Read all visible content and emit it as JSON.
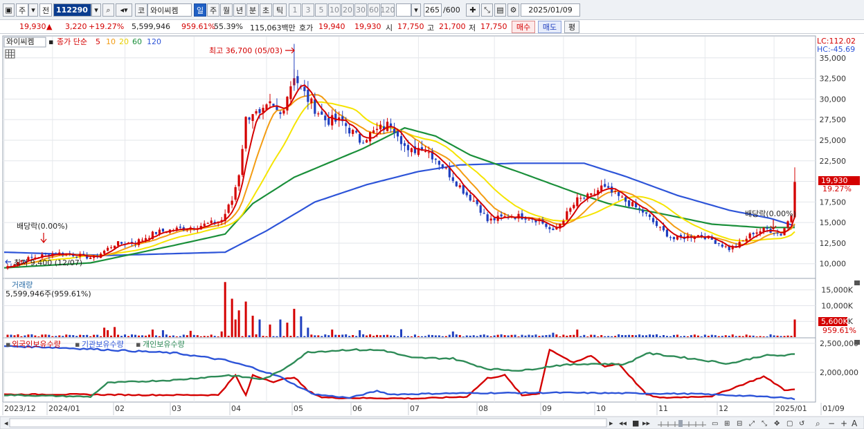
{
  "toolbar": {
    "market": "주",
    "prev_label": "전",
    "code": "112290",
    "kind_label": "코",
    "stock_name": "와이씨켐",
    "periods": [
      "일",
      "주",
      "월",
      "년",
      "분",
      "초",
      "틱"
    ],
    "active_period": "일",
    "intervals": [
      "1",
      "3",
      "5",
      "10",
      "20",
      "30",
      "60",
      "120"
    ],
    "count": "265",
    "count_max": "/600",
    "date": "2025/01/09"
  },
  "quote": {
    "price": "19,930",
    "arrow": "▲",
    "change": "3,220",
    "change_pct": "+19.27%",
    "volume": "5,599,946",
    "volume_pct": "959.61%",
    "turnover": "55.39%",
    "amount": "115,063백만",
    "ask_label": "호가",
    "ask": "19,940",
    "bid": "19,930",
    "open_label": "시",
    "open": "17,750",
    "high_label": "고",
    "high": "21,700",
    "low_label": "저",
    "low": "17,750",
    "buy_label": "매수",
    "sell_label": "매도",
    "eval_label": "평"
  },
  "price_panel": {
    "legend_name": "와이씨켐",
    "legend_ma": "종가 단순",
    "ma_periods": [
      "5",
      "10",
      "20",
      "60",
      "120"
    ],
    "ma_colors": [
      "#d40000",
      "#f39c12",
      "#f5e400",
      "#1a8f3a",
      "#2d54d8"
    ],
    "lc": "LC:112.02",
    "hc": "HC:-45.69",
    "high_note": "최고 36,700 (05/03)",
    "low_note": "최저 9,400 (12/07)",
    "dividend_1": "배당락(0.00%)",
    "dividend_2": "배당락(0.00%)",
    "last_price": "19,930",
    "last_pct": "19.27%"
  },
  "volume_panel": {
    "title": "거래량",
    "value": "5,599,946주(959.61%)",
    "last": "5,600K",
    "last_pct": "959.61%"
  },
  "holding_panel": {
    "foreign": "외국인보유수량",
    "inst": "기관보유수량",
    "indiv": "개인보유수량",
    "colors": [
      "#d40000",
      "#2d54d8",
      "#2e8b57"
    ]
  },
  "x_axis": [
    "2023/12",
    "2024/01",
    "02",
    "03",
    "04",
    "05",
    "06",
    "07",
    "08",
    "09",
    "10",
    "11",
    "12",
    "2025/01",
    "01/09"
  ],
  "chart_data": [
    {
      "type": "candlestick",
      "title": "와이씨켐",
      "y_ticks": [
        10000,
        12500,
        15000,
        17500,
        20000,
        22500,
        25000,
        27500,
        30000,
        32500,
        35000
      ],
      "y_tick_labels": [
        "10,000",
        "12,500",
        "15,000",
        "17,500",
        "20,000",
        "22,500",
        "25,000",
        "27,500",
        "30,000",
        "32,500",
        "35,000"
      ],
      "ylim": [
        8300,
        37500
      ],
      "close_series": [
        [
          0,
          9500
        ],
        [
          5,
          10400
        ],
        [
          10,
          10900
        ],
        [
          15,
          11300
        ],
        [
          20,
          11100
        ],
        [
          26,
          10700
        ],
        [
          32,
          12400
        ],
        [
          38,
          12600
        ],
        [
          44,
          13800
        ],
        [
          50,
          14200
        ],
        [
          55,
          14500
        ],
        [
          60,
          14900
        ],
        [
          63,
          15300
        ],
        [
          66,
          17700
        ],
        [
          68,
          21000
        ],
        [
          70,
          27500
        ],
        [
          72,
          28500
        ],
        [
          74,
          27800
        ],
        [
          77,
          29200
        ],
        [
          80,
          28100
        ],
        [
          84,
          33000
        ],
        [
          86,
          31200
        ],
        [
          89,
          29400
        ],
        [
          93,
          27500
        ],
        [
          98,
          27200
        ],
        [
          103,
          25000
        ],
        [
          109,
          26400
        ],
        [
          112,
          27000
        ],
        [
          114,
          26000
        ],
        [
          117,
          23400
        ],
        [
          121,
          24300
        ],
        [
          125,
          22800
        ],
        [
          130,
          20400
        ],
        [
          134,
          18400
        ],
        [
          137,
          17300
        ],
        [
          140,
          15200
        ],
        [
          143,
          15500
        ],
        [
          147,
          15800
        ],
        [
          151,
          15700
        ],
        [
          155,
          15300
        ],
        [
          159,
          13800
        ],
        [
          162,
          15500
        ],
        [
          166,
          17700
        ],
        [
          170,
          18200
        ],
        [
          173,
          19300
        ],
        [
          176,
          18600
        ],
        [
          180,
          17600
        ],
        [
          185,
          16300
        ],
        [
          190,
          14200
        ],
        [
          194,
          13000
        ],
        [
          198,
          13300
        ],
        [
          202,
          13500
        ],
        [
          206,
          12700
        ],
        [
          210,
          11800
        ],
        [
          213,
          12400
        ],
        [
          217,
          13800
        ],
        [
          221,
          14200
        ],
        [
          225,
          13600
        ],
        [
          229,
          16700
        ]
      ],
      "ma60_series": [
        [
          0,
          9500
        ],
        [
          25,
          10100
        ],
        [
          50,
          12300
        ],
        [
          64,
          13600
        ],
        [
          72,
          17300
        ],
        [
          84,
          20500
        ],
        [
          104,
          24000
        ],
        [
          116,
          26500
        ],
        [
          125,
          25500
        ],
        [
          135,
          23200
        ],
        [
          150,
          21000
        ],
        [
          165,
          18700
        ],
        [
          175,
          17300
        ],
        [
          190,
          16100
        ],
        [
          205,
          14800
        ],
        [
          219,
          14400
        ],
        [
          229,
          14400
        ]
      ],
      "ma120_series": [
        [
          0,
          11400
        ],
        [
          30,
          11000
        ],
        [
          64,
          11400
        ],
        [
          76,
          14000
        ],
        [
          90,
          17500
        ],
        [
          105,
          19600
        ],
        [
          120,
          21200
        ],
        [
          132,
          22000
        ],
        [
          148,
          22200
        ],
        [
          168,
          22200
        ],
        [
          180,
          20600
        ],
        [
          195,
          18300
        ],
        [
          210,
          16500
        ],
        [
          222,
          15500
        ],
        [
          229,
          14600
        ]
      ],
      "high_point": {
        "x": 84,
        "y": 36700
      },
      "low_point": {
        "x": 0,
        "y": 9400
      }
    },
    {
      "type": "bar",
      "title": "거래량",
      "y_ticks": [
        5000,
        10000,
        15000
      ],
      "y_tick_labels": [
        "5,000K",
        "10,000K",
        "15,000K"
      ],
      "ylim": [
        0,
        18000
      ],
      "spikes": [
        [
          29,
          3000
        ],
        [
          30,
          2200
        ],
        [
          32,
          3200
        ],
        [
          43,
          2400
        ],
        [
          46,
          2200
        ],
        [
          54,
          2000
        ],
        [
          63,
          1800
        ],
        [
          64,
          17500
        ],
        [
          66,
          12200
        ],
        [
          67,
          5600
        ],
        [
          68,
          8500
        ],
        [
          70,
          11300
        ],
        [
          72,
          6800
        ],
        [
          74,
          5600
        ],
        [
          77,
          4000
        ],
        [
          80,
          5600
        ],
        [
          82,
          4600
        ],
        [
          84,
          9000
        ],
        [
          86,
          6600
        ],
        [
          88,
          3000
        ],
        [
          95,
          2400
        ],
        [
          103,
          2200
        ],
        [
          115,
          2500
        ],
        [
          130,
          1800
        ],
        [
          159,
          1400
        ],
        [
          166,
          2400
        ],
        [
          229,
          5600
        ]
      ]
    },
    {
      "type": "line",
      "title": "보유수량",
      "y_ticks": [
        2000000,
        2500000
      ],
      "y_tick_labels": [
        "2,000,000",
        "2,500,000"
      ],
      "ylim": [
        1500000,
        2560000
      ],
      "series": [
        {
          "name": "외국인보유수량",
          "points": [
            [
              0,
              1620
            ],
            [
              20,
              1620
            ],
            [
              40,
              1610
            ],
            [
              62,
              1610
            ],
            [
              67,
              1950
            ],
            [
              70,
              1600
            ],
            [
              72,
              1950
            ],
            [
              78,
              1840
            ],
            [
              84,
              1920
            ],
            [
              88,
              1680
            ],
            [
              92,
              1570
            ],
            [
              96,
              1560
            ],
            [
              120,
              1550
            ],
            [
              134,
              1580
            ],
            [
              140,
              1900
            ],
            [
              145,
              1950
            ],
            [
              150,
              1600
            ],
            [
              155,
              1640
            ],
            [
              158,
              2400
            ],
            [
              165,
              2160
            ],
            [
              170,
              2290
            ],
            [
              174,
              2100
            ],
            [
              178,
              2150
            ],
            [
              186,
              1620
            ],
            [
              190,
              1560
            ],
            [
              205,
              1590
            ],
            [
              220,
              1930
            ],
            [
              224,
              1780
            ],
            [
              226,
              1700
            ],
            [
              229,
              1700
            ]
          ]
        },
        {
          "name": "기관보유수량",
          "points": [
            [
              0,
              2450
            ],
            [
              10,
              2440
            ],
            [
              30,
              2390
            ],
            [
              50,
              2330
            ],
            [
              64,
              2210
            ],
            [
              72,
              2080
            ],
            [
              80,
              1920
            ],
            [
              86,
              1730
            ],
            [
              90,
              1620
            ],
            [
              100,
              1560
            ],
            [
              108,
              1680
            ],
            [
              112,
              1620
            ],
            [
              130,
              1640
            ],
            [
              160,
              1650
            ],
            [
              200,
              1630
            ],
            [
              225,
              1570
            ],
            [
              229,
              1540
            ]
          ]
        },
        {
          "name": "개인보유수량",
          "points": [
            [
              0,
              1610
            ],
            [
              25,
              1580
            ],
            [
              30,
              1820
            ],
            [
              50,
              1870
            ],
            [
              65,
              1950
            ],
            [
              75,
              1880
            ],
            [
              80,
              2020
            ],
            [
              88,
              2350
            ],
            [
              100,
              2390
            ],
            [
              110,
              2380
            ],
            [
              118,
              2250
            ],
            [
              130,
              2240
            ],
            [
              140,
              2060
            ],
            [
              150,
              2030
            ],
            [
              160,
              2120
            ],
            [
              170,
              2150
            ],
            [
              180,
              2140
            ],
            [
              186,
              2330
            ],
            [
              195,
              2270
            ],
            [
              210,
              2150
            ],
            [
              220,
              2290
            ],
            [
              226,
              2290
            ],
            [
              229,
              2310
            ]
          ]
        }
      ]
    }
  ]
}
